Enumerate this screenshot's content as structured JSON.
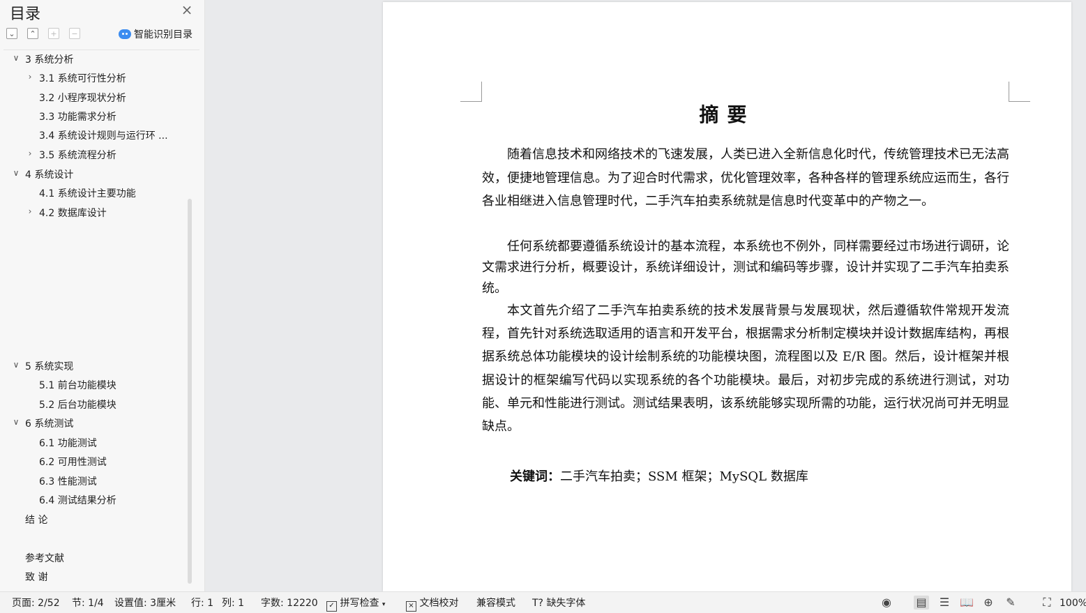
{
  "sidebar": {
    "title": "目录",
    "smart_button": "智能识别目录",
    "items": [
      {
        "label": "3  系统分析",
        "expanded": true
      },
      {
        "label": "3.1  系统可行性分析",
        "expanded": false
      },
      {
        "label": "3.2  小程序现状分析"
      },
      {
        "label": "3.3  功能需求分析"
      },
      {
        "label": "3.4  系统设计规则与运行环 ..."
      },
      {
        "label": "3.5 系统流程分析",
        "expanded": false
      },
      {
        "label": "4  系统设计",
        "expanded": true
      },
      {
        "label": "4.1  系统设计主要功能"
      },
      {
        "label": "4.2  数据库设计",
        "expanded": false
      },
      {
        "label": "5  系统实现",
        "expanded": true
      },
      {
        "label": "5.1 前台功能模块"
      },
      {
        "label": "5.2 后台功能模块"
      },
      {
        "label": "6  系统测试",
        "expanded": true
      },
      {
        "label": "6.1  功能测试"
      },
      {
        "label": "6.2  可用性测试"
      },
      {
        "label": "6.3  性能测试"
      },
      {
        "label": "6.4  测试结果分析"
      },
      {
        "label": "结  论"
      },
      {
        "label": "参考文献"
      },
      {
        "label": "致  谢"
      }
    ]
  },
  "document": {
    "heading": "摘要",
    "paragraphs": [
      "随着信息技术和网络技术的飞速发展，人类已进入全新信息化时代，传统管理技术已无法高效，便捷地管理信息。为了迎合时代需求，优化管理效率，各种各样的管理系统应运而生，各行各业相继进入信息管理时代，二手汽车拍卖系统就是信息时代变革中的产物之一。",
      "任何系统都要遵循系统设计的基本流程，本系统也不例外，同样需要经过市场进行调研，论文需求进行分析，概要设计，系统详细设计，测试和编码等步骤，设计并实现了二手汽车拍卖系统。",
      "本文首先介绍了二手汽车拍卖系统的技术发展背景与发展现状，然后遵循软件常规开发流程，首先针对系统选取适用的语言和开发平台，根据需求分析制定模块并设计数据库结构，再根据系统总体功能模块的设计绘制系统的功能模块图，流程图以及 E/R 图。然后，设计框架并根据设计的框架编写代码以实现系统的各个功能模块。最后，对初步完成的系统进行测试，对功能、单元和性能进行测试。测试结果表明，该系统能够实现所需的功能，运行状况尚可并无明显缺点。"
    ],
    "keywords_label": "关键词：",
    "keywords": "二手汽车拍卖；SSM 框架；MySQL 数据库"
  },
  "statusbar": {
    "page": "页面: 2/52",
    "section": "节: 1/4",
    "setting": "设置值: 3厘米",
    "row": "行: 1",
    "col": "列: 1",
    "words": "字数: 12220",
    "spell_check": "拼写检查",
    "proofread": "文档校对",
    "compat": "兼容模式",
    "missing_font": "缺失字体",
    "zoom": "100%"
  }
}
